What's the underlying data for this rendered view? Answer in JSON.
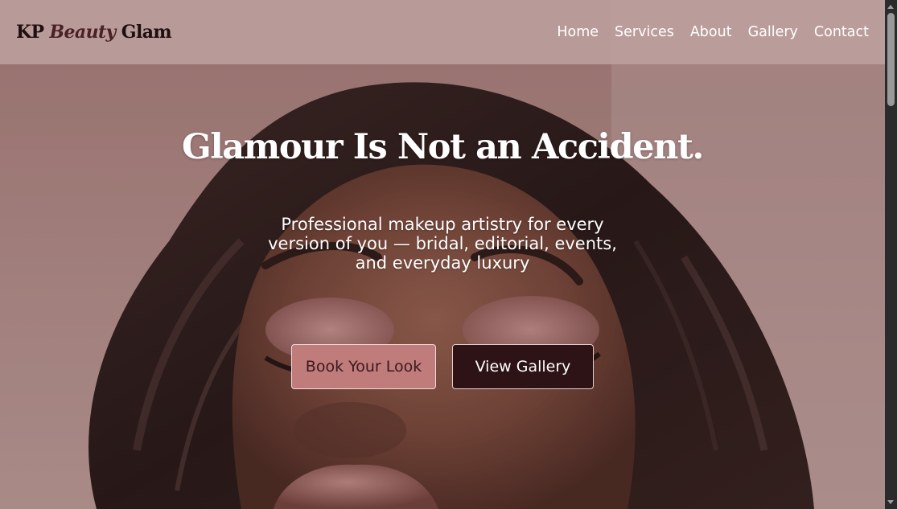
{
  "brand": {
    "part1": "KP ",
    "part2": "Beauty",
    "part3": " Glam"
  },
  "nav": {
    "items": [
      {
        "label": "Home"
      },
      {
        "label": "Services"
      },
      {
        "label": "About"
      },
      {
        "label": "Gallery"
      },
      {
        "label": "Contact"
      }
    ]
  },
  "hero": {
    "title": "Glamour Is Not an Accident.",
    "subtitle": "Professional makeup artistry for every version of you — bridal, editorial, events, and everyday luxury",
    "primary_button": "Book Your Look",
    "secondary_button": "View Gallery",
    "image_description_icon": "hero-portrait-image"
  },
  "colors": {
    "nav_background": "#bea2a0",
    "primary_button": "#c07b7b",
    "secondary_button": "#2d1216",
    "brand_text": "#1e0f10"
  }
}
